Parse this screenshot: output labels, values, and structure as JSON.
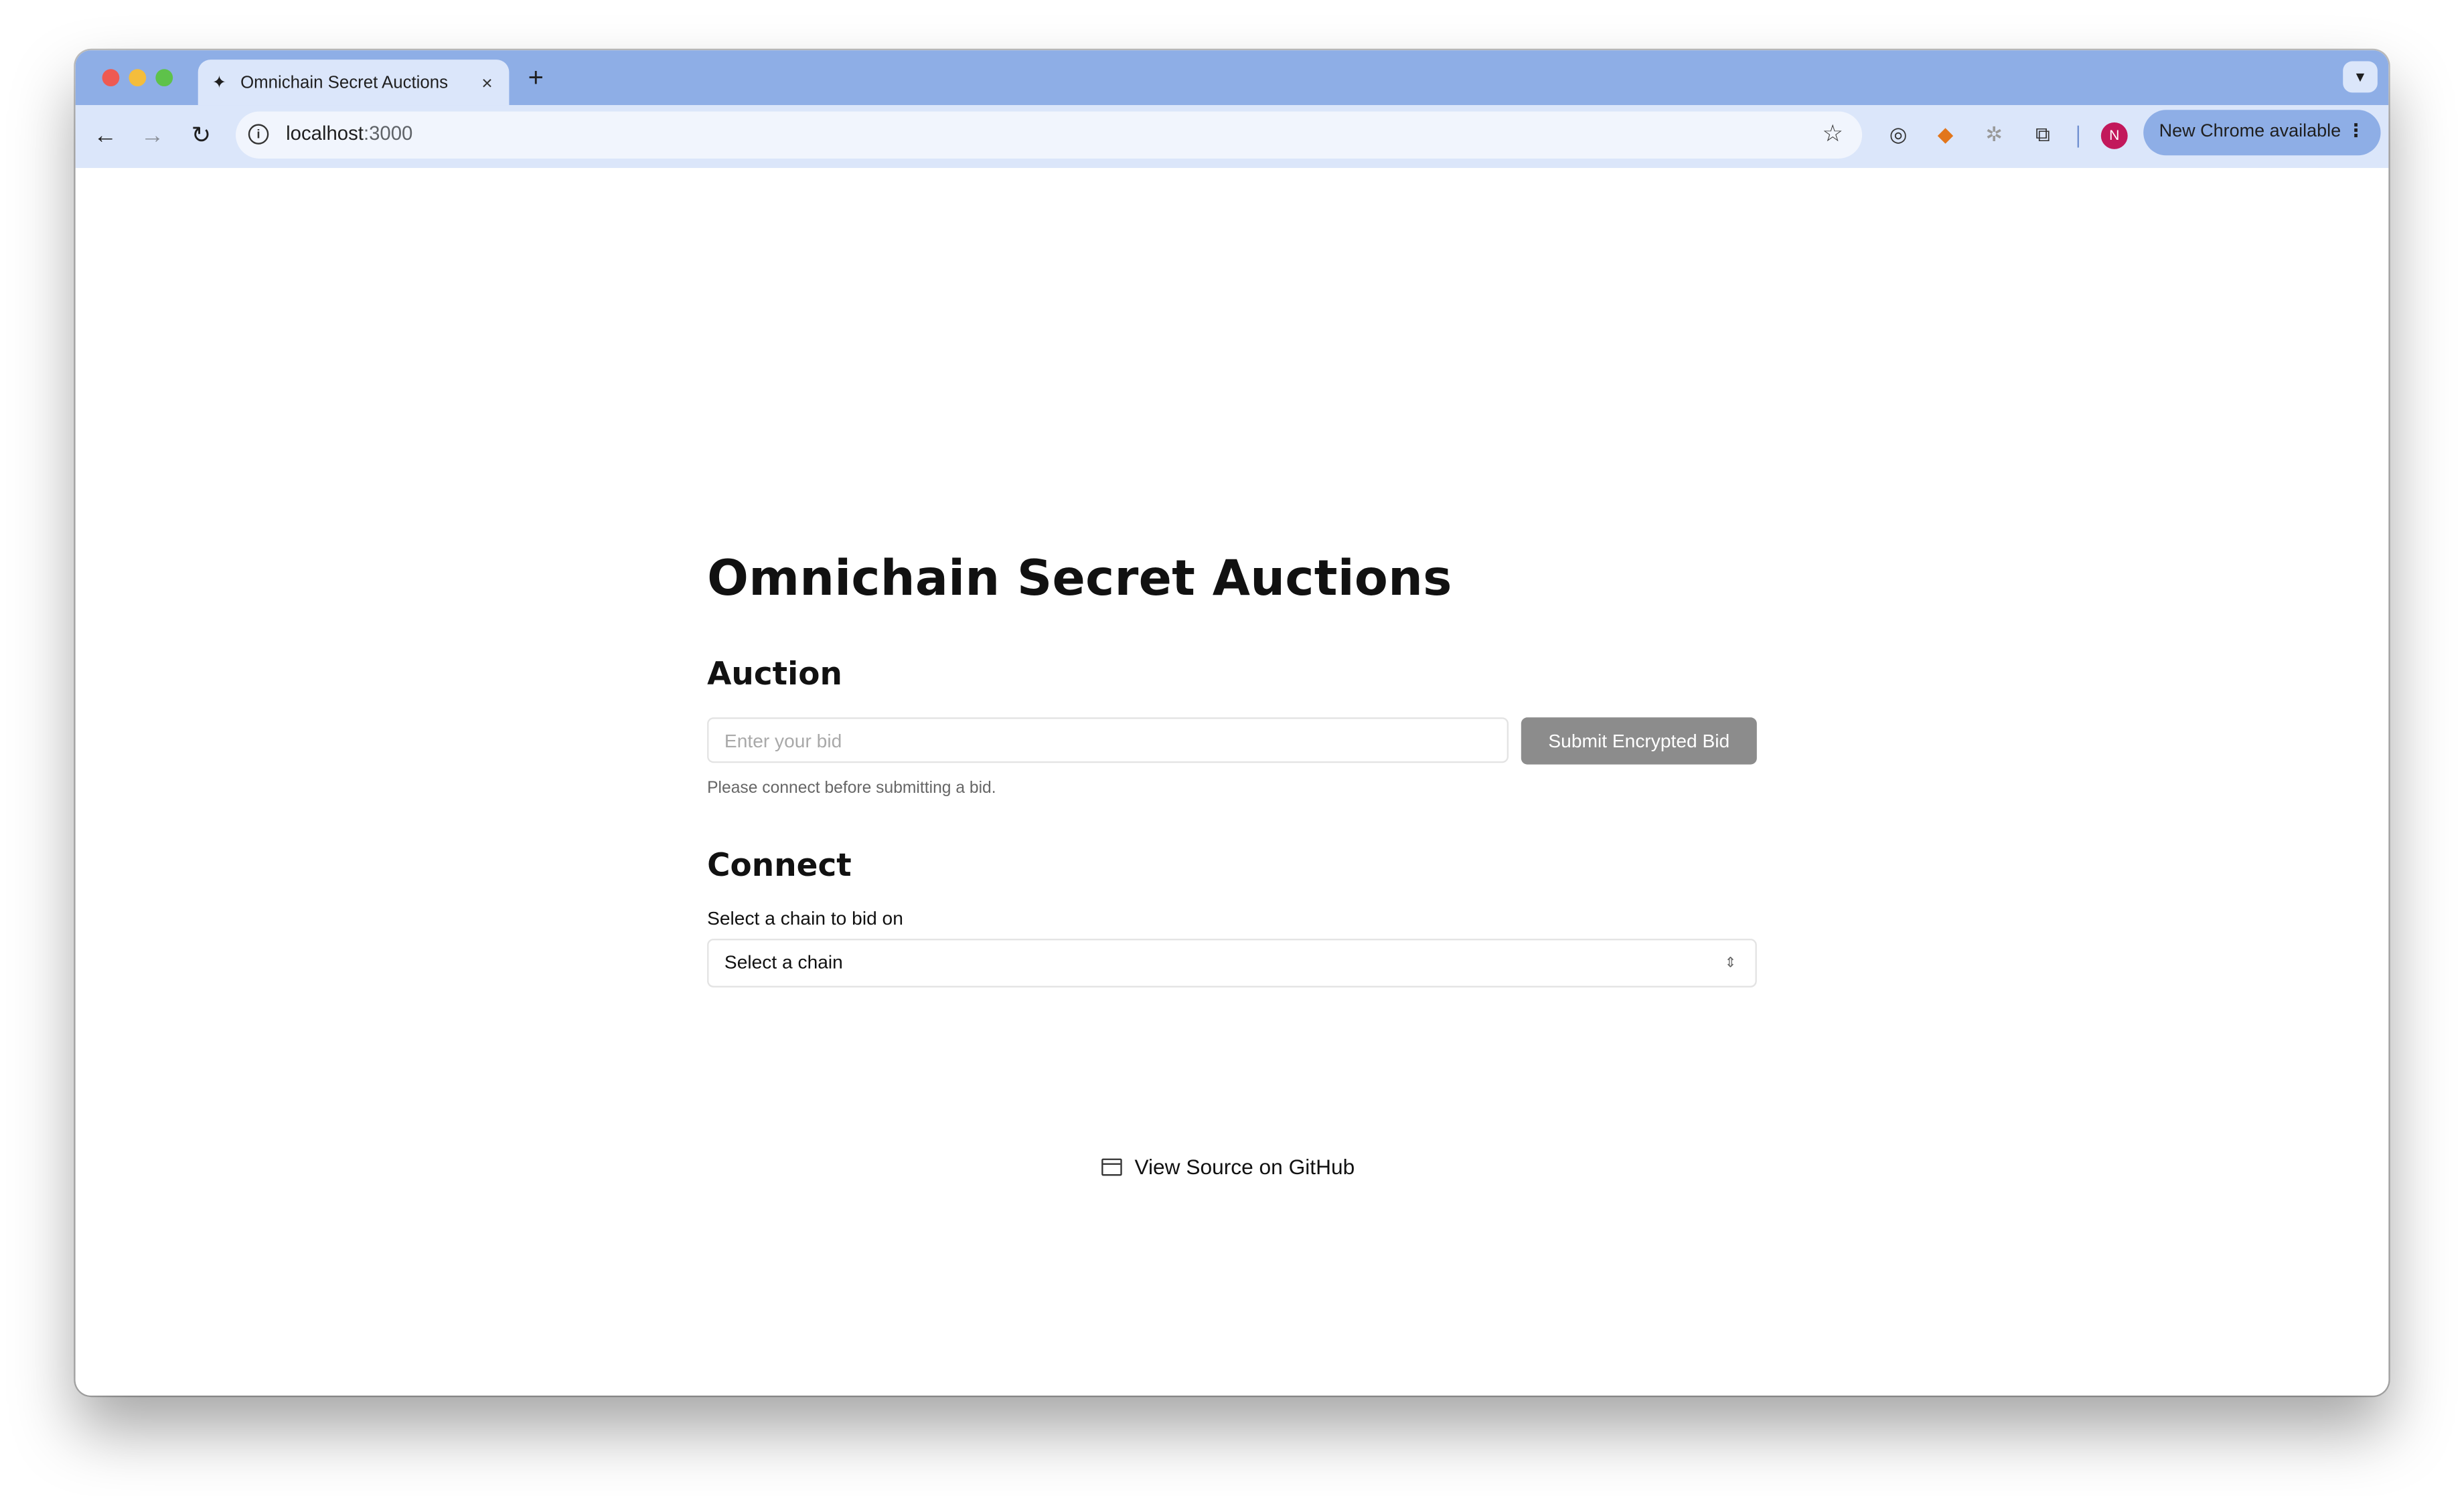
{
  "browser": {
    "tab_title": "Omnichain Secret Auctions",
    "tab_close": "×",
    "new_tab": "+",
    "url_host": "localhost",
    "url_port": ":3000",
    "update_button": "New Chrome available",
    "profile_initial": "N"
  },
  "page": {
    "title": "Omnichain Secret Auctions",
    "auction": {
      "heading": "Auction",
      "bid_placeholder": "Enter your bid",
      "submit_label": "Submit Encrypted Bid",
      "hint": "Please connect before submitting a bid."
    },
    "connect": {
      "heading": "Connect",
      "chain_label": "Select a chain to bid on",
      "chain_selected": "Select a chain"
    },
    "footer": {
      "github_link": "View Source on GitHub"
    }
  },
  "icons": {
    "back": "arrow-left-icon",
    "forward": "arrow-right-icon",
    "reload": "reload-icon",
    "info": "info-icon",
    "bookmark": "star-icon",
    "extensions": "puzzle-icon",
    "metamask": "fox-icon",
    "github": "window-icon"
  },
  "colors": {
    "titlebar": "#8eaee6",
    "toolbar": "#dbe6fa",
    "submit_button": "#8c8c8c",
    "avatar": "#c2185b"
  }
}
